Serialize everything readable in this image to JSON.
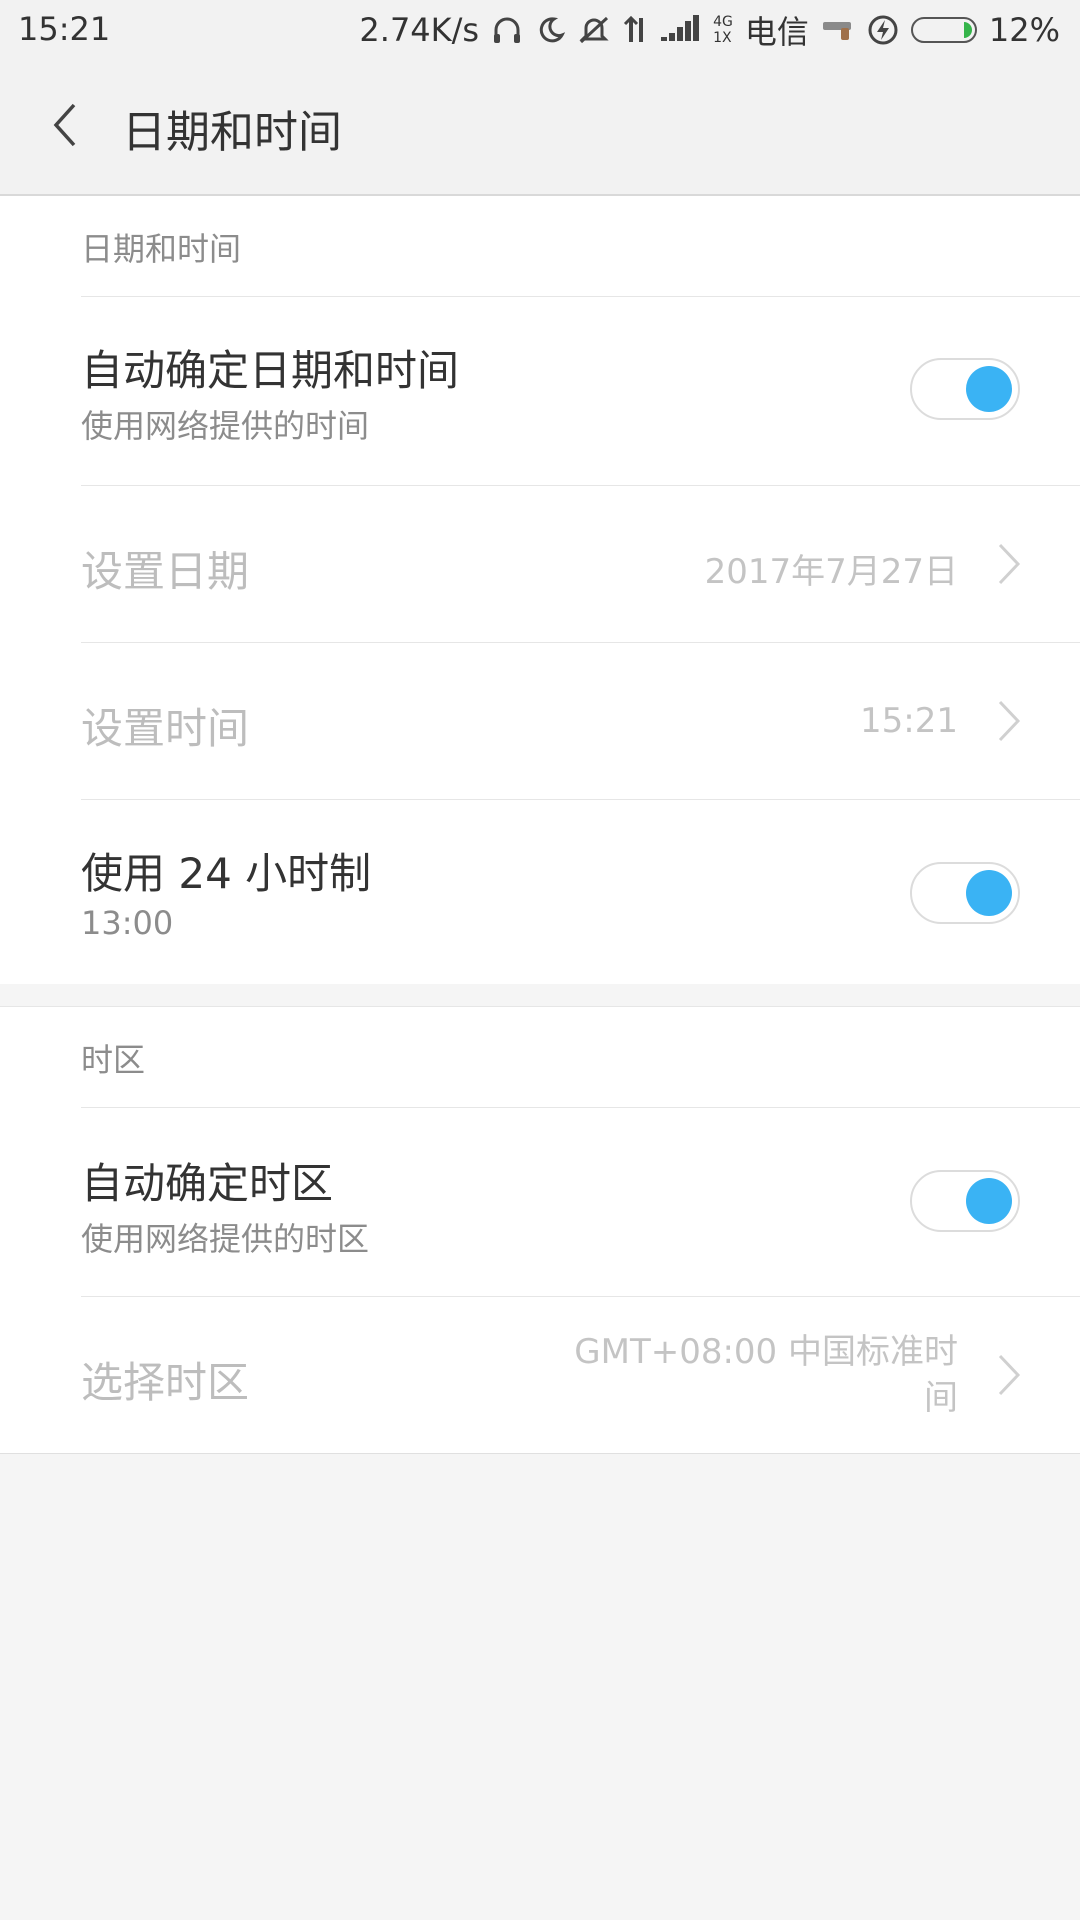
{
  "status_bar": {
    "time": "15:21",
    "net_speed": "2.74K/s",
    "network_small_top": "4G",
    "network_small_bottom": "1X",
    "carrier": "电信",
    "battery_percent": "12%",
    "battery_level": 0.12,
    "icons": [
      "headphones-icon",
      "moon-icon",
      "mute-icon",
      "data-arrows-icon",
      "signal-icon",
      "gun-icon",
      "charging-icon",
      "battery-icon"
    ]
  },
  "action_bar": {
    "title": "日期和时间",
    "back_icon": "chevron-left-icon"
  },
  "section_datetime": {
    "header": "日期和时间",
    "auto_datetime": {
      "title": "自动确定日期和时间",
      "subtitle": "使用网络提供的时间",
      "enabled": true
    },
    "set_date": {
      "title": "设置日期",
      "value": "2017年7月27日"
    },
    "set_time": {
      "title": "设置时间",
      "value": "15:21"
    },
    "use_24h": {
      "title": "使用 24 小时制",
      "subtitle": "13:00",
      "enabled": true
    }
  },
  "section_timezone": {
    "header": "时区",
    "auto_timezone": {
      "title": "自动确定时区",
      "subtitle": "使用网络提供的时区",
      "enabled": true
    },
    "select_timezone": {
      "title": "选择时区",
      "value_line1": "GMT+08:00 中国标准时",
      "value_line2": "间"
    }
  },
  "colors": {
    "toggle_on": "#3ab3f4",
    "battery_fill": "#35b44a",
    "background": "#f5f5f5"
  }
}
